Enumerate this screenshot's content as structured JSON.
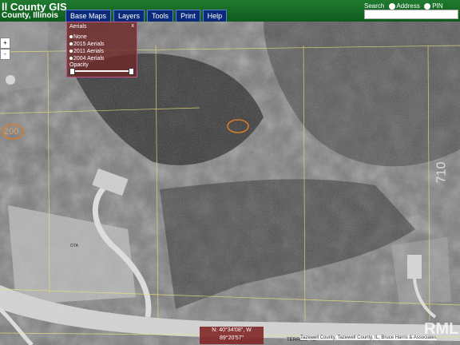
{
  "header": {
    "title": "ll County GIS",
    "subtitle": "County, Illinois",
    "nav": [
      "Base Maps",
      "Layers",
      "Tools",
      "Print",
      "Help"
    ],
    "search": {
      "label": "Search",
      "options": [
        "Address",
        "PIN"
      ]
    }
  },
  "aerials_panel": {
    "title": "Aerials",
    "close": "x",
    "options": [
      "None",
      "2015 Aerials",
      "2011 Aerials",
      "2004 Aerials"
    ],
    "opacity_label": "Opacity"
  },
  "zoom": {
    "in": "+",
    "out": "-"
  },
  "map": {
    "parcel_labels": [
      "200",
      "710"
    ],
    "road_name": "TERRELL RD",
    "lot_label": "OTA"
  },
  "coordinates": {
    "lat": "N: 40°34'08\", W",
    "lon": "89°20'57\""
  },
  "attribution": "Tazewell County, Tazewell County, IL, Bruce Harris & Associates",
  "watermark": "RML",
  "colors": {
    "header_green": "#1f7a2e",
    "nav_blue": "#0b2a7a",
    "panel_red": "#6e2828",
    "parcel_line": "#e9e37a"
  }
}
